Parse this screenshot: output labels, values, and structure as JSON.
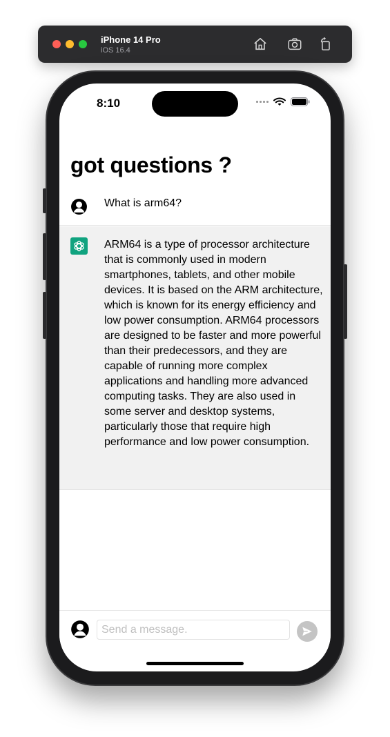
{
  "window": {
    "device_name": "iPhone 14 Pro",
    "os_version": "iOS 16.4",
    "home_icon": "home-icon",
    "screenshot_icon": "camera-icon",
    "rotate_icon": "rotate-icon"
  },
  "status_bar": {
    "time": "8:10"
  },
  "page": {
    "title": "got questions ?"
  },
  "conversation": {
    "user_message": "What is arm64?",
    "assistant_message": "ARM64 is a type of processor architecture that is commonly used in modern smartphones, tablets, and other mobile devices. It is based on the ARM architecture, which is known for its energy efficiency and low power consumption. ARM64 processors are designed to be faster and more powerful than their predecessors, and they are capable of running more complex applications and handling more advanced computing tasks. They are also used in some server and desktop systems, particularly those that require high performance and low power consumption."
  },
  "composer": {
    "placeholder": "Send a message.",
    "value": ""
  },
  "colors": {
    "assistant_bg": "#f1f1f1",
    "logo_green": "#10a37f",
    "send_button": "#c4c4c4"
  }
}
